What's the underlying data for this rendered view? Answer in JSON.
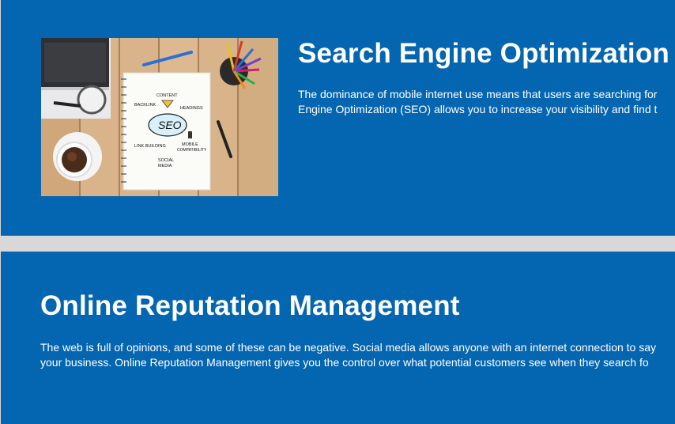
{
  "seo": {
    "image_alt": "SEO notebook sketch on wooden desk",
    "image_words": {
      "content": "CONTENT",
      "backlink": "BACKLINK",
      "headings": "HEADINGS",
      "seo": "SEO",
      "link_building": "LINK BUILDING",
      "mobile": "MOBILE",
      "compatibility": "COMPATIBILITY",
      "social": "SOCIAL",
      "media": "MEDIA"
    },
    "title": "Search Engine Optimization",
    "text_line1": "The dominance of mobile internet use means that users are searching for",
    "text_line2": "Engine Optimization (SEO) allows you to increase your visibility and find t"
  },
  "orm": {
    "title": "Online Reputation Management",
    "text_line1": "The web is full of opinions, and some of these can be negative. Social media allows anyone with an internet connection to say",
    "text_line2": "your business. Online Reputation Management gives you the control over what potential customers see when they search fo"
  },
  "colors": {
    "section_bg": "#0465b0",
    "divider": "#d8d8d8",
    "text": "#ffffff"
  }
}
